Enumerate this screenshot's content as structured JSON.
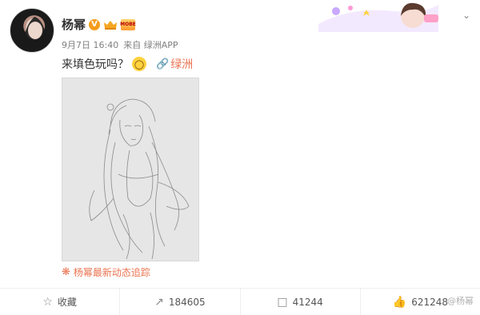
{
  "user": {
    "name": "杨幂",
    "verified_mark": "V",
    "member_badge": "MOBE"
  },
  "meta": {
    "time": "9月7日 16:40",
    "source": "来自 绿洲APP"
  },
  "post": {
    "text": "来填色玩吗？",
    "emoji": "scream-emoji",
    "topic_label": "绿洲"
  },
  "image": {
    "description": "pencil-sketch"
  },
  "tracker": {
    "label": "杨幂最新动态追踪"
  },
  "actions": [
    {
      "icon": "star-icon",
      "label": "收藏"
    },
    {
      "icon": "repost-icon",
      "label": "184605"
    },
    {
      "icon": "comment-icon",
      "label": "41244"
    },
    {
      "icon": "like-icon",
      "label": "621248"
    }
  ],
  "watermark": "@杨幂",
  "colors": {
    "accent": "#eb7350",
    "vip": "#f59c1a",
    "muted": "#808080"
  }
}
